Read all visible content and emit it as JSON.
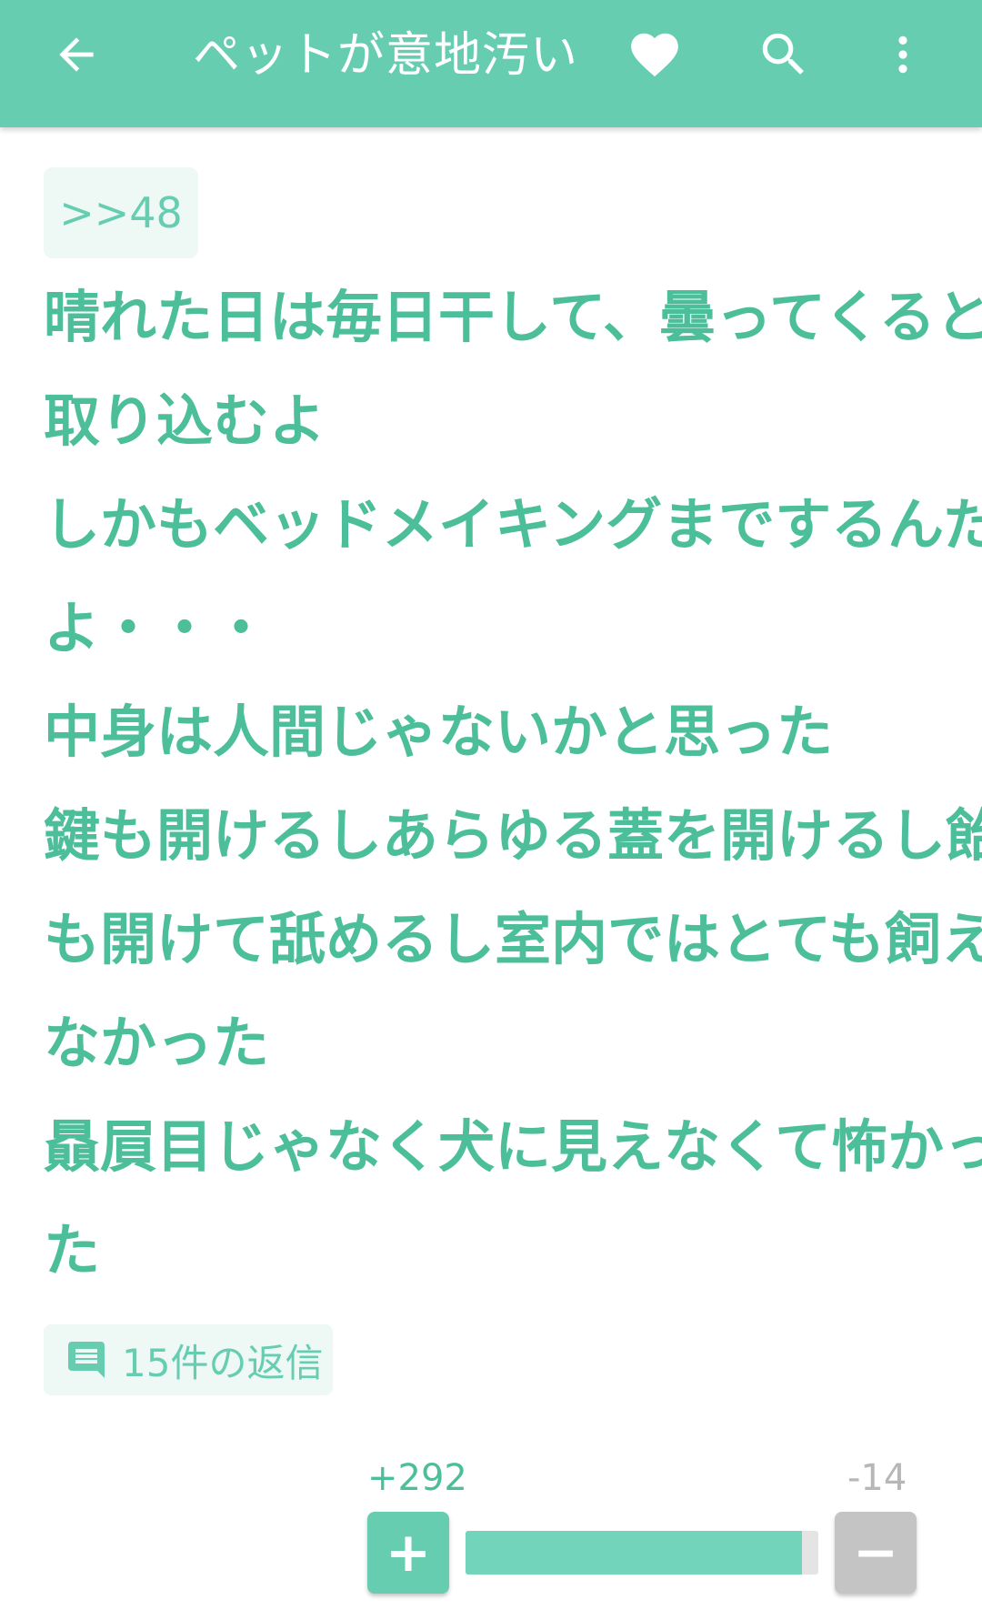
{
  "header": {
    "title": "ペットが意地汚い",
    "icons": {
      "back": "arrow-left-icon",
      "favorite": "heart-icon",
      "search": "search-icon",
      "menu": "more-vert-icon"
    }
  },
  "post": {
    "quote_ref": ">>48",
    "lines": [
      "晴れた日は毎日干して、曇ってくると",
      "取り込むよ",
      "しかもベッドメイキングまでするんだ",
      "よ・・・",
      "中身は人間じゃないかと思った",
      "鍵も開けるしあらゆる蓋を開けるし飴",
      "も開けて舐めるし室内ではとても飼え",
      "なかった",
      "贔屓目じゃなく犬に見えなくて怖かっ",
      "た"
    ],
    "replies_label": "15件の返信",
    "replies_icon": "comment-icon"
  },
  "votes": {
    "plus_label": "+292",
    "minus_label": "-14",
    "plus_button": "+",
    "minus_button": "−",
    "plus_ratio": 0.954
  },
  "colors": {
    "accent": "#67cdb1",
    "text": "#4cbf9a",
    "chip_bg": "#eef8f5",
    "minus": "#c4c4c4"
  }
}
